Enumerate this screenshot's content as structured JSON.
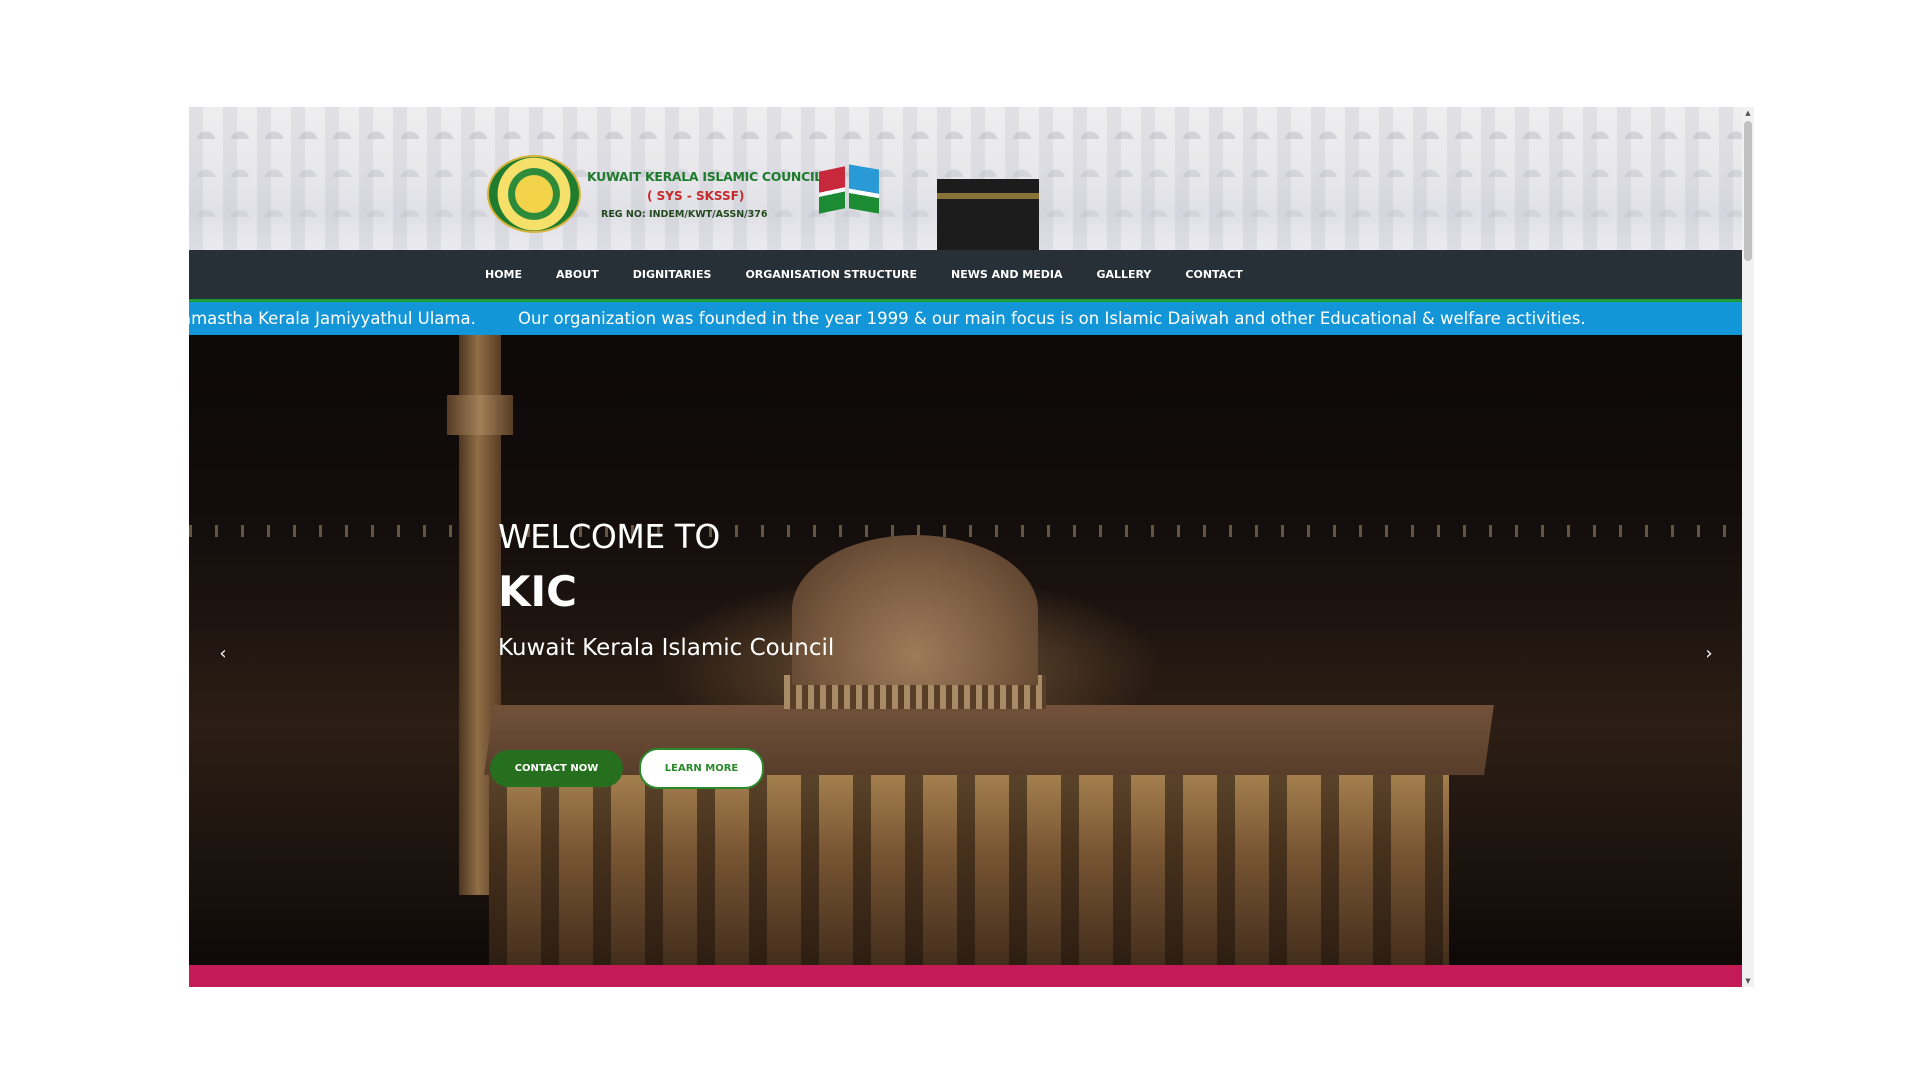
{
  "header": {
    "logo_title": "KUWAIT KERALA ISLAMIC COUNCIL",
    "logo_subtitle": "( SYS - SKSSF)",
    "logo_reg": "REG NO: INDEM/KWT/ASSN/376"
  },
  "nav": {
    "items": [
      "HOME",
      "ABOUT",
      "DIGNITARIES",
      "ORGANISATION STRUCTURE",
      "NEWS AND MEDIA",
      "GALLERY",
      "CONTACT"
    ]
  },
  "marquee": {
    "text_1": "amastha Kerala Jamiyyathul Ulama.",
    "text_2": "Our organization was founded in the year 1999 & our main focus is on Islamic Daiwah and other Educational & welfare activities."
  },
  "hero": {
    "welcome": "WELCOME TO",
    "title": "KIC",
    "subtitle": "Kuwait Kerala Islamic Council",
    "contact_button": "CONTACT NOW",
    "learn_button": "LEARN MORE",
    "prev_icon": "chevron-left-icon",
    "next_icon": "chevron-right-icon"
  },
  "scrollbar": {
    "up_icon": "scroll-up-arrow-icon",
    "down_icon": "scroll-down-arrow-icon"
  },
  "colors": {
    "nav_bg": "#283037",
    "nav_border": "#1d9a3a",
    "marquee_bg": "#1396d8",
    "primary_button": "#266f1e",
    "accent_bar": "#c41a56"
  }
}
